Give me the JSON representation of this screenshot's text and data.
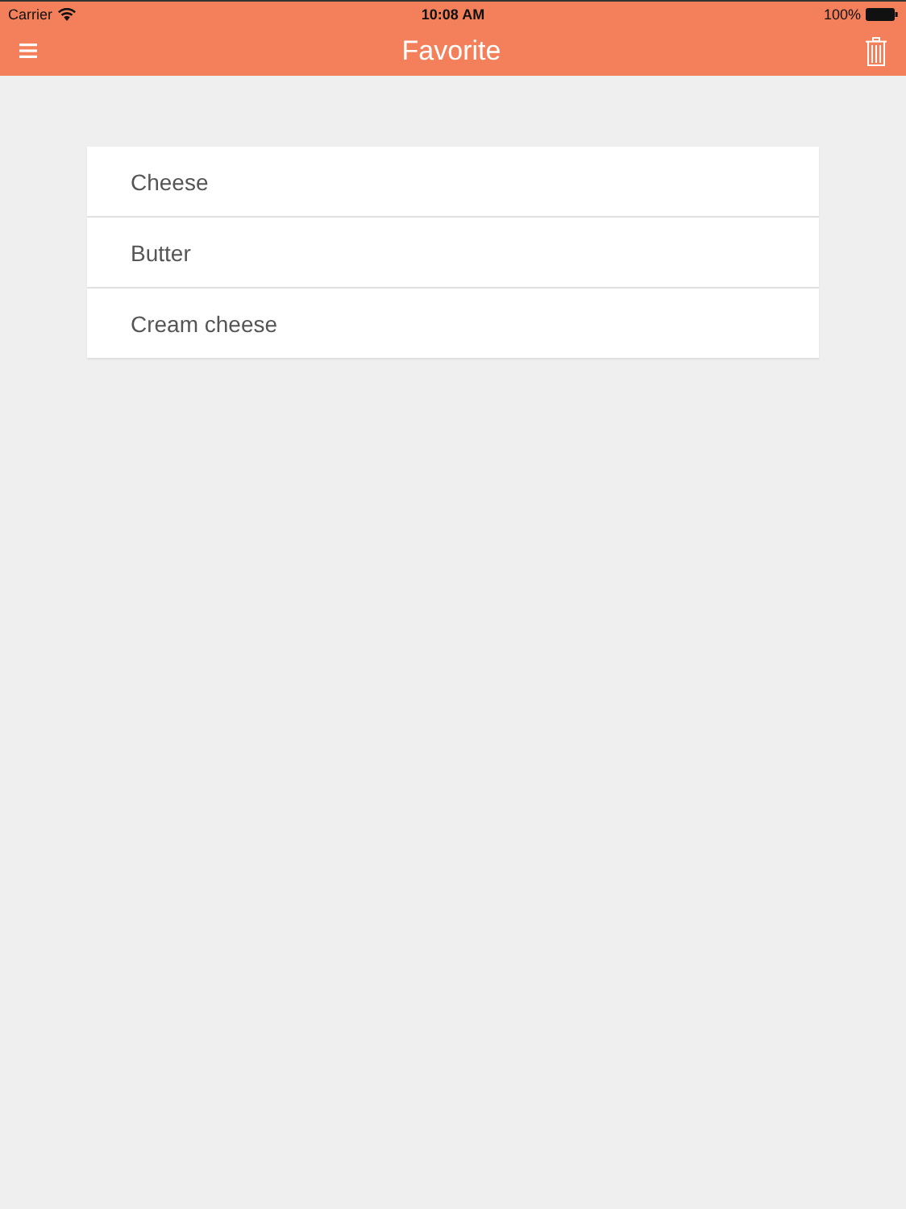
{
  "status_bar": {
    "carrier": "Carrier",
    "time": "10:08 AM",
    "battery": "100%"
  },
  "nav_bar": {
    "title": "Favorite"
  },
  "favorites": [
    {
      "label": "Cheese"
    },
    {
      "label": "Butter"
    },
    {
      "label": "Cream cheese"
    }
  ]
}
